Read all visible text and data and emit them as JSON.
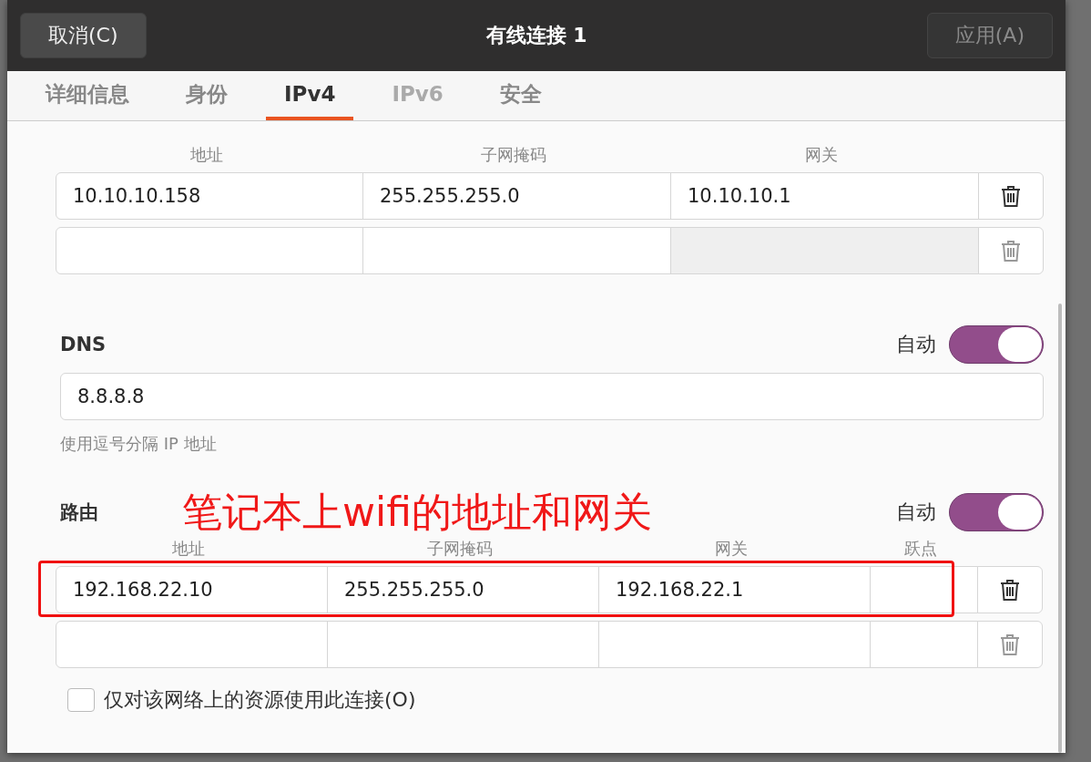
{
  "header": {
    "cancel_button": "取消(C)",
    "title": "有线连接 1",
    "apply_button": {
      "label": "应用(A)",
      "disabled": true
    }
  },
  "tabs": [
    {
      "label": "详细信息",
      "selected": false,
      "disabled": false
    },
    {
      "label": "身份",
      "selected": false,
      "disabled": false
    },
    {
      "label": "IPv4",
      "selected": true,
      "disabled": false
    },
    {
      "label": "IPv6",
      "selected": false,
      "disabled": true
    },
    {
      "label": "安全",
      "selected": false,
      "disabled": false
    }
  ],
  "addresses": {
    "columns": [
      "地址",
      "子网掩码",
      "网关"
    ],
    "rows": [
      {
        "kind": "filled",
        "values": [
          "10.10.10.158",
          "255.255.255.0",
          "10.10.10.1"
        ]
      },
      {
        "kind": "blank"
      }
    ]
  },
  "dns": {
    "label": "DNS",
    "auto_label": "自动",
    "auto": true,
    "value": "8.8.8.8",
    "hint": "使用逗号分隔 IP 地址"
  },
  "routes": {
    "label": "路由",
    "annotation": "笔记本上wifi的地址和网关",
    "auto_label": "自动",
    "auto": true,
    "columns": [
      "地址",
      "子网掩码",
      "网关",
      "跃点"
    ],
    "rows": [
      {
        "kind": "filled",
        "values": [
          "192.168.22.10",
          "255.255.255.0",
          "192.168.22.1"
        ],
        "highlighted": true
      },
      {
        "kind": "blank",
        "highlighted": false
      }
    ]
  },
  "only_local": {
    "label": "仅对该网络上的资源使用此连接(O)",
    "checked": false
  }
}
